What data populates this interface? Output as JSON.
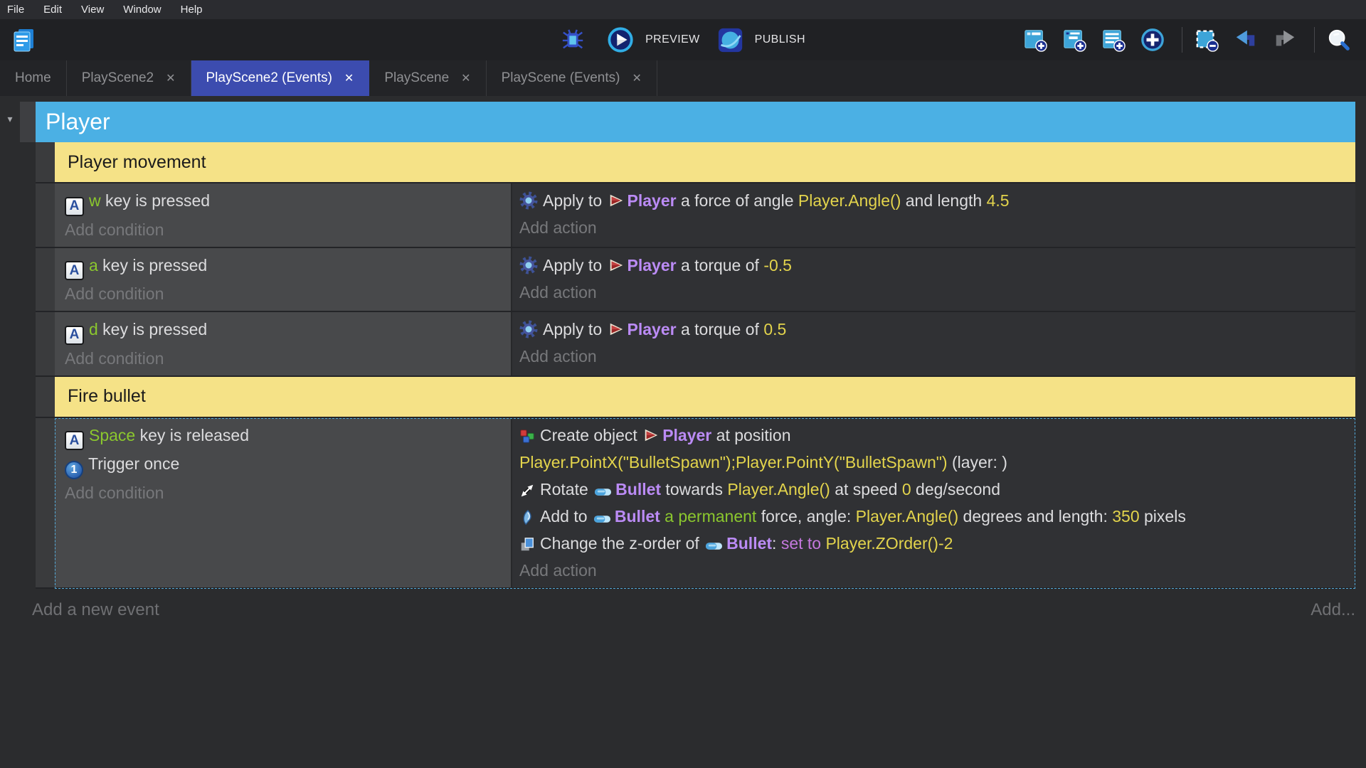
{
  "colors": {
    "active_tab": "#3c4caf",
    "scene_header_blue": "#4bb0e4",
    "group_yellow": "#f5e287",
    "object_purple": "#bb8bf5",
    "expression_yellow": "#e3d44c",
    "key_green": "#8bc72e",
    "selection_dash": "#54aad9"
  },
  "menu": {
    "items": [
      "File",
      "Edit",
      "View",
      "Window",
      "Help"
    ]
  },
  "toolbar": {
    "preview_label": "PREVIEW",
    "publish_label": "PUBLISH",
    "icons": [
      "project-manager-icon",
      "debug-icon",
      "preview-play-icon",
      "publish-globe-icon",
      "add-event-icon",
      "add-subevent-icon",
      "add-comment-icon",
      "add-circle-icon",
      "delete-selection-icon",
      "undo-icon",
      "redo-icon",
      "search-icon"
    ]
  },
  "tabs": [
    {
      "label": "Home",
      "closable": false,
      "active": false
    },
    {
      "label": "PlayScene2",
      "closable": true,
      "active": false
    },
    {
      "label": "PlayScene2 (Events)",
      "closable": true,
      "active": true
    },
    {
      "label": "PlayScene",
      "closable": true,
      "active": false
    },
    {
      "label": "PlayScene (Events)",
      "closable": true,
      "active": false
    }
  ],
  "sheet": {
    "title": "Player"
  },
  "events": [
    {
      "type": "group",
      "label": "Player movement"
    },
    {
      "type": "standard",
      "selected": false,
      "conditions": {
        "add_label": "Add condition",
        "lines": [
          {
            "icon": "keyboard-key-icon",
            "segments": [
              {
                "t": "w",
                "c": "key"
              },
              {
                "t": " key is pressed",
                "c": "plain"
              }
            ]
          }
        ]
      },
      "actions": {
        "add_label": "Add action",
        "lines": [
          {
            "icon": "physics-force-icon",
            "segments": [
              {
                "t": "Apply to ",
                "c": "plain"
              },
              {
                "t": "Player",
                "c": "object",
                "icon": "player-object-icon"
              },
              {
                "t": " a force of angle ",
                "c": "plain"
              },
              {
                "t": "Player.Angle()",
                "c": "expr"
              },
              {
                "t": " and length ",
                "c": "plain"
              },
              {
                "t": "4.5",
                "c": "expr"
              }
            ]
          }
        ]
      }
    },
    {
      "type": "standard",
      "selected": false,
      "conditions": {
        "add_label": "Add condition",
        "lines": [
          {
            "icon": "keyboard-key-icon",
            "segments": [
              {
                "t": "a",
                "c": "key"
              },
              {
                "t": " key is pressed",
                "c": "plain"
              }
            ]
          }
        ]
      },
      "actions": {
        "add_label": "Add action",
        "lines": [
          {
            "icon": "physics-force-icon",
            "segments": [
              {
                "t": "Apply to ",
                "c": "plain"
              },
              {
                "t": "Player",
                "c": "object",
                "icon": "player-object-icon"
              },
              {
                "t": " a torque of ",
                "c": "plain"
              },
              {
                "t": "-0.5",
                "c": "expr"
              }
            ]
          }
        ]
      }
    },
    {
      "type": "standard",
      "selected": false,
      "conditions": {
        "add_label": "Add condition",
        "lines": [
          {
            "icon": "keyboard-key-icon",
            "segments": [
              {
                "t": "d",
                "c": "key"
              },
              {
                "t": " key is pressed",
                "c": "plain"
              }
            ]
          }
        ]
      },
      "actions": {
        "add_label": "Add action",
        "lines": [
          {
            "icon": "physics-force-icon",
            "segments": [
              {
                "t": "Apply to ",
                "c": "plain"
              },
              {
                "t": "Player",
                "c": "object",
                "icon": "player-object-icon"
              },
              {
                "t": " a torque of ",
                "c": "plain"
              },
              {
                "t": "0.5",
                "c": "expr"
              }
            ]
          }
        ]
      }
    },
    {
      "type": "group",
      "label": "Fire bullet"
    },
    {
      "type": "standard",
      "selected": true,
      "conditions": {
        "add_label": "Add condition",
        "lines": [
          {
            "icon": "keyboard-key-icon",
            "segments": [
              {
                "t": "Space",
                "c": "key"
              },
              {
                "t": " key is released",
                "c": "plain"
              }
            ]
          },
          {
            "icon": "trigger-once-icon",
            "segments": [
              {
                "t": "Trigger once",
                "c": "plain"
              }
            ]
          }
        ]
      },
      "actions": {
        "add_label": "Add action",
        "lines": [
          {
            "icon": "create-object-icon",
            "segments": [
              {
                "t": "Create object ",
                "c": "plain"
              },
              {
                "t": "Player",
                "c": "object",
                "icon": "player-object-icon"
              },
              {
                "t": " at position",
                "c": "plain"
              }
            ]
          },
          {
            "segments": [
              {
                "t": "Player.PointX(\"BulletSpawn\");Player.PointY(\"BulletSpawn\")",
                "c": "expr"
              },
              {
                "t": " (layer: )",
                "c": "plain"
              }
            ]
          },
          {
            "icon": "rotate-icon",
            "segments": [
              {
                "t": "Rotate ",
                "c": "plain"
              },
              {
                "t": "Bullet",
                "c": "object",
                "icon": "bullet-object-icon"
              },
              {
                "t": " towards ",
                "c": "plain"
              },
              {
                "t": "Player.Angle()",
                "c": "expr"
              },
              {
                "t": " at speed ",
                "c": "plain"
              },
              {
                "t": "0",
                "c": "expr"
              },
              {
                "t": " deg/second",
                "c": "plain"
              }
            ]
          },
          {
            "icon": "permanent-force-icon",
            "segments": [
              {
                "t": "Add to ",
                "c": "plain"
              },
              {
                "t": "Bullet",
                "c": "object",
                "icon": "bullet-object-icon"
              },
              {
                "t": " a permanent",
                "c": "green"
              },
              {
                "t": " force, angle: ",
                "c": "plain"
              },
              {
                "t": "Player.Angle()",
                "c": "expr"
              },
              {
                "t": " degrees and length: ",
                "c": "plain"
              },
              {
                "t": "350",
                "c": "expr"
              },
              {
                "t": " pixels",
                "c": "plain"
              }
            ]
          },
          {
            "icon": "z-order-icon",
            "segments": [
              {
                "t": "Change the z-order of ",
                "c": "plain"
              },
              {
                "t": "Bullet",
                "c": "object",
                "icon": "bullet-object-icon"
              },
              {
                "t": ": ",
                "c": "plain"
              },
              {
                "t": "set to ",
                "c": "violet"
              },
              {
                "t": "Player.ZOrder()-2",
                "c": "expr"
              }
            ]
          }
        ]
      }
    }
  ],
  "footer": {
    "add_event_label": "Add a new event",
    "add_more_label": "Add..."
  }
}
